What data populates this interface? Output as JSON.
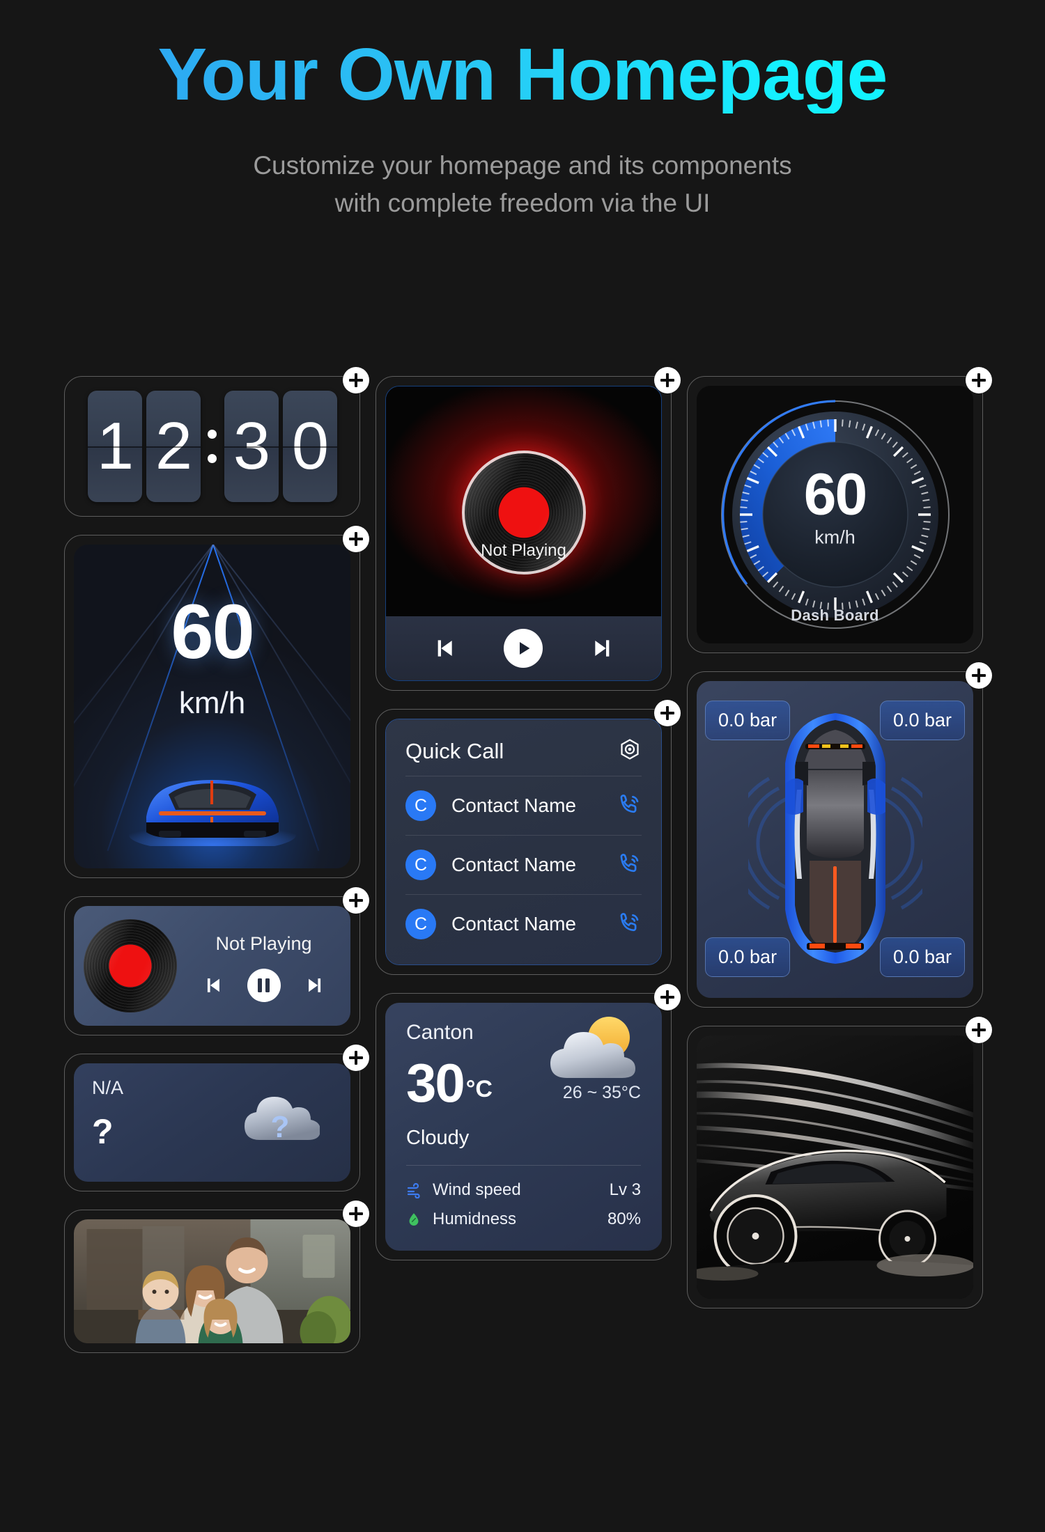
{
  "header": {
    "title": "Your Own Homepage",
    "subtitle_line1": "Customize your homepage and its components",
    "subtitle_line2": "with complete freedom via the UI",
    "title_gradient_from": "#2f9bf0",
    "title_gradient_to": "#0ff7ff",
    "subtitle_color": "#9b9b9b",
    "background": "#161616"
  },
  "add_button": {
    "icon": "plus-icon",
    "label": "+"
  },
  "widgets": {
    "clock": {
      "name": "Flip Clock",
      "digits": [
        "1",
        "2",
        "3",
        "0"
      ],
      "separator": ":",
      "time": "12:30"
    },
    "music_large": {
      "name": "Music Player",
      "status": "Not Playing",
      "prev_icon": "skip-previous-icon",
      "play_icon": "play-icon",
      "next_icon": "skip-next-icon",
      "accent": "#ee1111"
    },
    "dashboard": {
      "name": "Dash Board",
      "value": "60",
      "unit": "km/h",
      "label": "Dash Board",
      "arc_color": "#1565e8",
      "max": 240,
      "current": 60
    },
    "speed_hud": {
      "name": "Speed HUD",
      "value": "60",
      "unit": "km/h"
    },
    "quick_call": {
      "name": "Quick Call",
      "title": "Quick Call",
      "settings_icon": "hex-settings-icon",
      "contacts": [
        {
          "initial": "C",
          "name": "Contact Name",
          "call_icon": "phone-call-icon"
        },
        {
          "initial": "C",
          "name": "Contact Name",
          "call_icon": "phone-call-icon"
        },
        {
          "initial": "C",
          "name": "Contact Name",
          "call_icon": "phone-call-icon"
        }
      ],
      "avatar_color": "#2979f5",
      "call_icon_color": "#2a7bf0"
    },
    "tire_pressure": {
      "name": "Tire Pressure",
      "unit": "bar",
      "front_left": "0.0",
      "front_right": "0.0",
      "rear_left": "0.0",
      "rear_right": "0.0",
      "front_left_label": "0.0 bar",
      "front_right_label": "0.0 bar",
      "rear_left_label": "0.0 bar",
      "rear_right_label": "0.0 bar"
    },
    "music_small": {
      "name": "Music Mini",
      "status": "Not Playing",
      "prev_icon": "skip-previous-icon",
      "pause_icon": "pause-icon",
      "next_icon": "skip-next-icon"
    },
    "weather_na": {
      "name": "Weather Unavailable",
      "city": "N/A",
      "temperature": "?",
      "icon": "cloud-question-icon"
    },
    "weather": {
      "name": "Weather",
      "city": "Canton",
      "temperature": "30",
      "unit": "°C",
      "range": "26 ~ 35°C",
      "condition": "Cloudy",
      "icon": "sun-behind-cloud-icon",
      "details": [
        {
          "icon": "wind-icon",
          "label": "Wind speed",
          "value": "Lv 3",
          "color": "#3d7bf0"
        },
        {
          "icon": "humidity-icon",
          "label": "Humidness",
          "value": "80%",
          "color": "#3fc160"
        }
      ]
    },
    "photo_family": {
      "name": "Family Photo",
      "alt": "family-photo"
    },
    "photo_car": {
      "name": "Car Wallpaper",
      "alt": "sports-car-photo"
    }
  }
}
